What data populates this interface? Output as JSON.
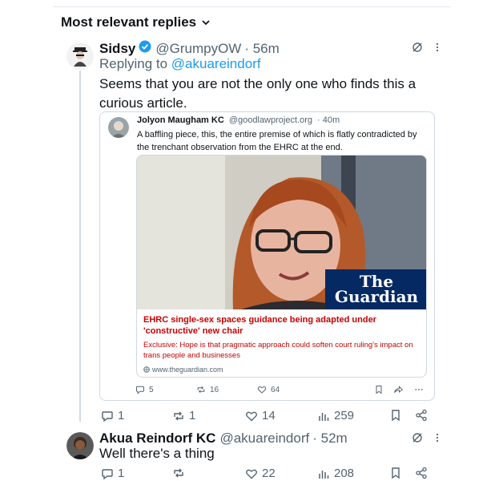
{
  "section": {
    "title": "Most relevant replies"
  },
  "tweet1": {
    "name": "Sidsy",
    "handle": "@GrumpyOW",
    "time": "· 56m",
    "replying_prefix": "Replying to ",
    "replying_handle": "@akuareindorf",
    "text": "Seems that you are not the only one who finds this a curious article.",
    "actions": {
      "replies": "1",
      "reposts": "1",
      "likes": "14",
      "views": "259"
    }
  },
  "quote": {
    "name": "Jolyon Maugham KC",
    "handle": "@goodlawproject.org",
    "time": "· 40m",
    "text": "A baffling piece, this, the entire premise of which is flatly contradicted by the trenchant observation from the EHRC at the end.",
    "card": {
      "brand_line1": "The",
      "brand_line2": "Guardian",
      "title": "EHRC single-sex spaces guidance being adapted under 'constructive' new chair",
      "subtitle": "Exclusive: Hope is that pragmatic approach could soften court ruling's impact on trans people and businesses",
      "url": "www.theguardian.com"
    },
    "actions": {
      "replies": "5",
      "reposts": "16",
      "likes": "64"
    }
  },
  "tweet2": {
    "name": "Akua Reindorf KC",
    "handle": "@akuareindorf",
    "time": "· 52m",
    "text": "Well there's a thing",
    "actions": {
      "replies": "1",
      "reposts": "",
      "likes": "22",
      "views": "208"
    }
  },
  "colors": {
    "link": "#1d9bf0",
    "verified": "#1d9bf0",
    "muted": "#536471",
    "guardian_bg": "#052962",
    "headline_red": "#c70000"
  }
}
